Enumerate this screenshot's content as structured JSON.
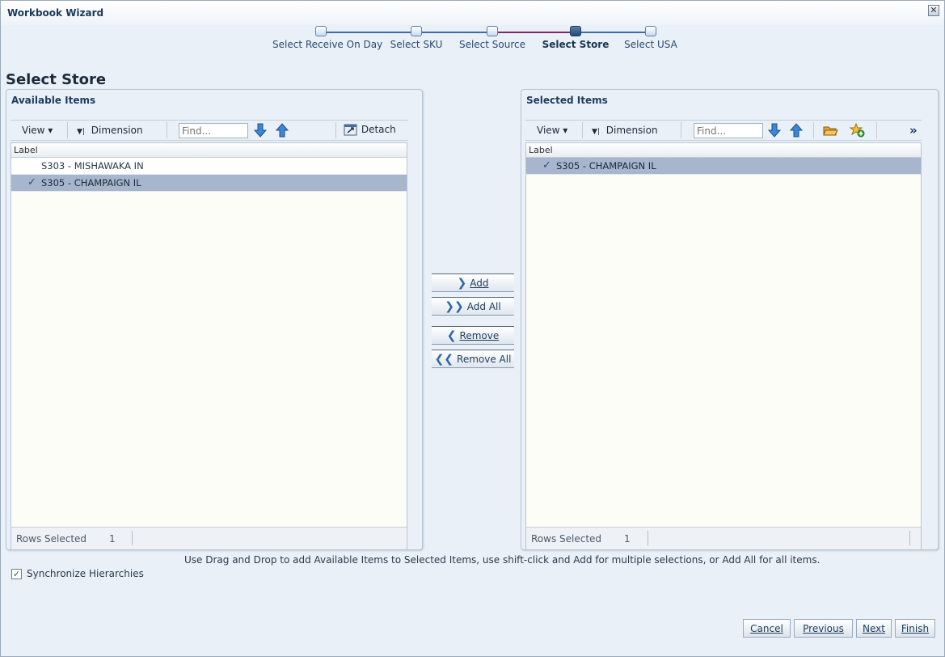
{
  "dialog": {
    "title": "Workbook Wizard",
    "close_label": "✕"
  },
  "train": {
    "stops": [
      {
        "label": "Select Receive On Day"
      },
      {
        "label": "Select SKU"
      },
      {
        "label": "Select Source"
      },
      {
        "label": "Select Store"
      },
      {
        "label": "Select USA"
      }
    ],
    "current": "Select Store"
  },
  "page": {
    "title": "Select Store"
  },
  "available": {
    "header": "Available Items",
    "toolbar": {
      "view": "View ▾",
      "dimension": "Dimension",
      "find_placeholder": "Find...",
      "detach": "Detach"
    },
    "column": "Label",
    "rows": [
      {
        "label": "S303 - MISHAWAKA IN",
        "checked": ""
      },
      {
        "label": "S305 - CHAMPAIGN IL",
        "checked": "✓"
      }
    ],
    "footer": {
      "label": "Rows Selected",
      "count": "1"
    }
  },
  "selected": {
    "header": "Selected Items",
    "toolbar": {
      "view": "View ▾",
      "dimension": "Dimension",
      "find_placeholder": "Find...",
      "more": "»"
    },
    "column": "Label",
    "rows": [
      {
        "label": "S305 - CHAMPAIGN IL",
        "checked": "✓"
      }
    ],
    "footer": {
      "label": "Rows Selected",
      "count": "1"
    }
  },
  "shuttle": {
    "add": "Add",
    "add_all": "Add All",
    "remove": "Remove",
    "remove_all": "Remove All"
  },
  "hint": "Use Drag and Drop to add Available Items to Selected Items, use shift-click and Add for multiple selections, or Add All for all items.",
  "sync": {
    "label": "Synchronize Hierarchies",
    "checked": "✓"
  },
  "buttons": {
    "cancel": "Cancel",
    "previous": "Previous",
    "next": "Next",
    "finish": "Finish"
  },
  "colors": {
    "accent": "#2f66a8",
    "selected_row": "#a7b5cd",
    "grid_bg": "#fcfdf7"
  }
}
